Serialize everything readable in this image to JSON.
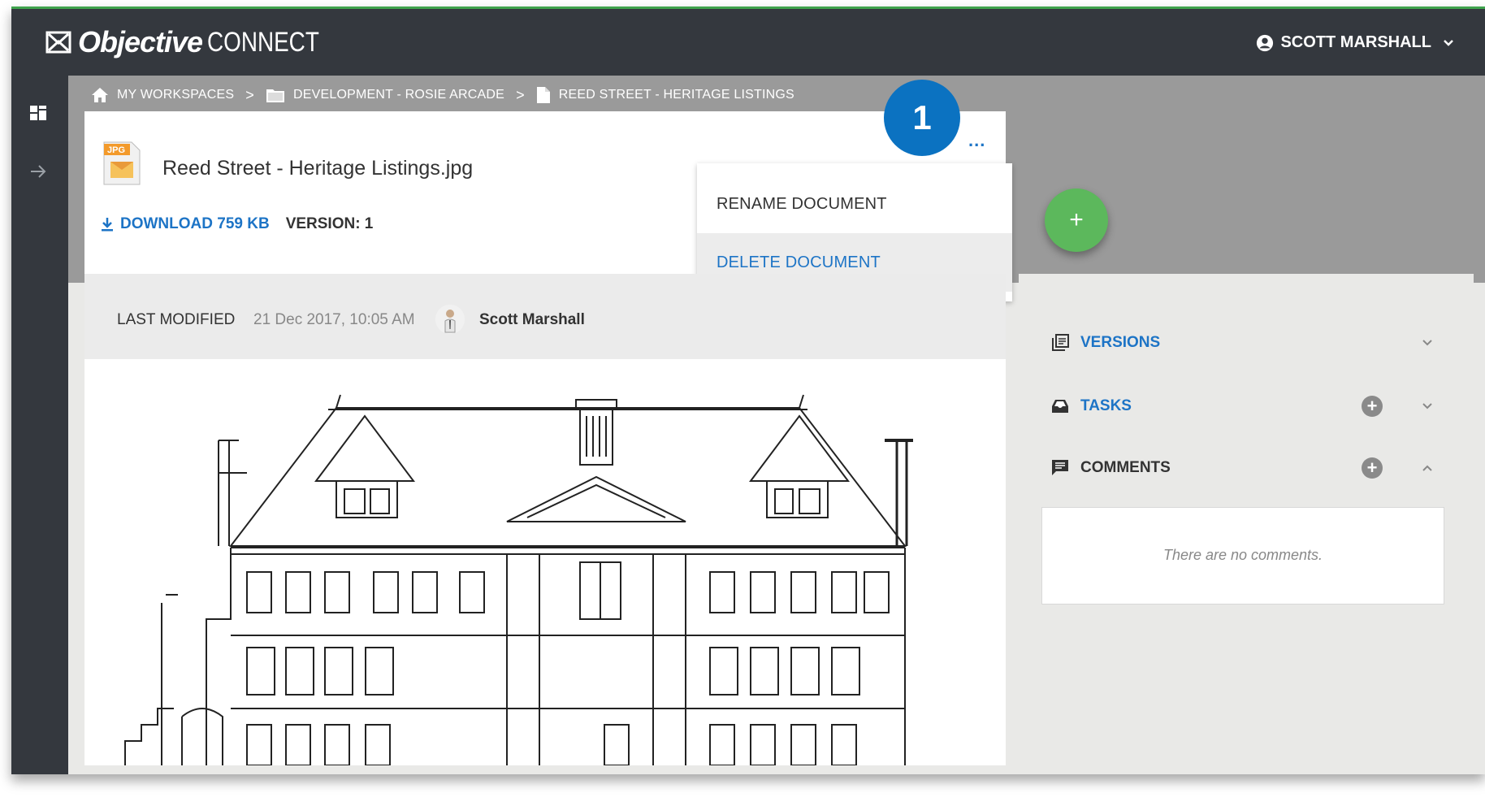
{
  "app": {
    "logo_bold": "Objective",
    "logo_light": "CONNECT",
    "user_name": "SCOTT MARSHALL"
  },
  "breadcrumb": {
    "items": [
      {
        "label": "MY WORKSPACES",
        "icon": "home-icon"
      },
      {
        "label": "DEVELOPMENT - ROSIE ARCADE",
        "icon": "folder-icon"
      },
      {
        "label": "REED STREET - HERITAGE LISTINGS",
        "icon": "document-icon"
      }
    ],
    "separator": ">"
  },
  "document": {
    "file_type": "JPG",
    "title": "Reed Street - Heritage Listings.jpg",
    "download_label": "DOWNLOAD 759 KB",
    "version_label": "VERSION: 1",
    "more_label": "..."
  },
  "callout_badge": "1",
  "menu": {
    "items": [
      {
        "label": "RENAME DOCUMENT"
      },
      {
        "label": "DELETE DOCUMENT"
      }
    ]
  },
  "fab_label": "+",
  "meta": {
    "last_modified_label": "LAST MODIFIED",
    "date": "21 Dec 2017, 10:05 AM",
    "user": "Scott Marshall"
  },
  "side_panel": {
    "versions_label": "VERSIONS",
    "tasks_label": "TASKS",
    "comments_label": "COMMENTS",
    "no_comments": "There are no comments."
  },
  "colors": {
    "accent": "#1d74c6",
    "topbar": "#34383e",
    "fab": "#5cb85c",
    "badge": "#0b72c1"
  }
}
